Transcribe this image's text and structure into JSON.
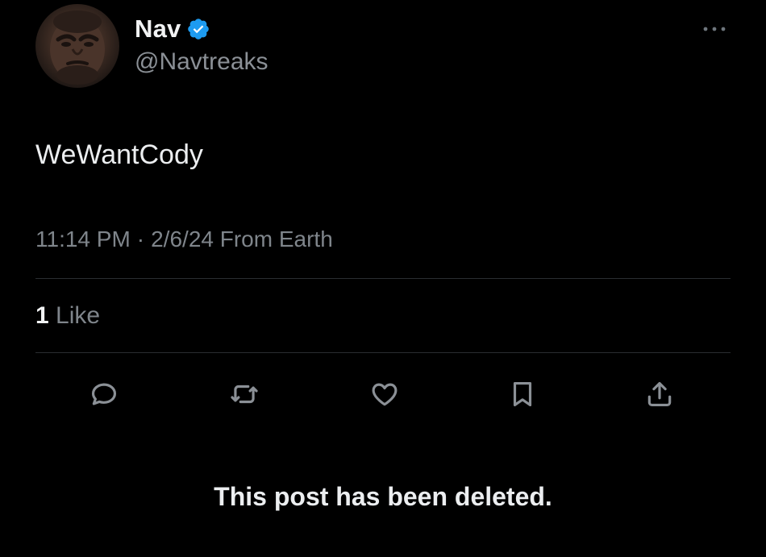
{
  "post": {
    "author": {
      "display_name": "Nav",
      "handle": "@Navtreaks",
      "verified_icon": "verified-badge-icon",
      "verified_color": "#1d9bf0"
    },
    "text": "WeWantCody",
    "time": "11:14 PM",
    "separator": "·",
    "date_source": "2/6/24 From Earth",
    "likes": {
      "count": "1",
      "label": "Like"
    },
    "actions": [
      {
        "icon": "reply-icon"
      },
      {
        "icon": "repost-icon"
      },
      {
        "icon": "like-icon"
      },
      {
        "icon": "bookmark-icon"
      },
      {
        "icon": "share-icon"
      }
    ],
    "more_icon": "more-options-icon"
  },
  "notice": {
    "text": "This post has been deleted."
  },
  "colors": {
    "background": "#000000",
    "text_primary": "#e7e9ea",
    "text_secondary": "#7f858b",
    "divider": "#2a2d31",
    "accent": "#1d9bf0"
  }
}
